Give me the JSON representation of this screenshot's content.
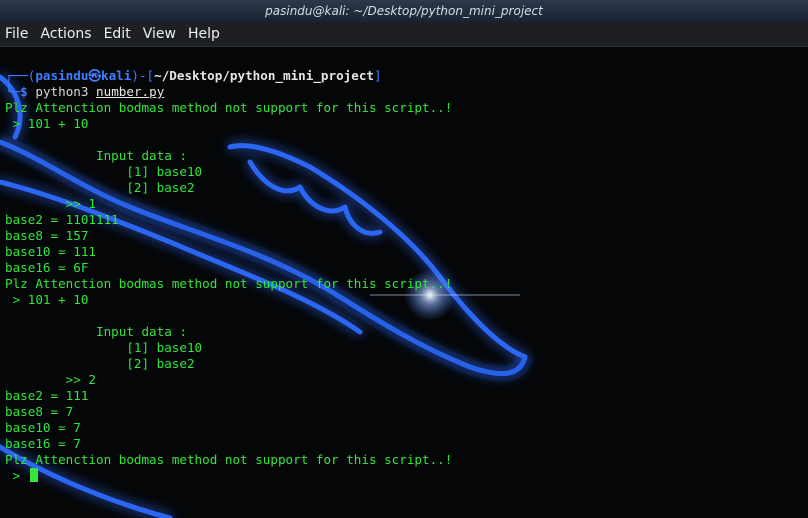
{
  "window": {
    "title": "pasindu@kali: ~/Desktop/python_mini_project"
  },
  "menu": {
    "items": [
      "File",
      "Actions",
      "Edit",
      "View",
      "Help"
    ]
  },
  "prompt": {
    "box_top": "┌──(",
    "user": "pasindu",
    "skull": "㉿",
    "host": "kali",
    "mid": ")-[",
    "path": "~/Desktop/python_mini_project",
    "close": "]",
    "box_bottom": "└─",
    "dollar": "$",
    "command": "python3",
    "script": "number.py"
  },
  "output": [
    "Plz Attenction bodmas method not support for this script..!",
    " > 101 + 10",
    "",
    "            Input data :",
    "                [1] base10",
    "                [2] base2",
    "        >> 1",
    "base2 = 1101111",
    "base8 = 157",
    "base10 = 111",
    "base16 = 6F",
    "Plz Attenction bodmas method not support for this script..!",
    " > 101 + 10",
    "",
    "            Input data :",
    "                [1] base10",
    "                [2] base2",
    "        >> 2",
    "base2 = 111",
    "base8 = 7",
    "base10 = 7",
    "base16 = 7",
    "Plz Attenction bodmas method not support for this script..!"
  ],
  "input_prompt": " > ",
  "colors": {
    "terminal_green": "#33e63a",
    "kali_blue": "#3f7dff",
    "background": "#050608"
  }
}
